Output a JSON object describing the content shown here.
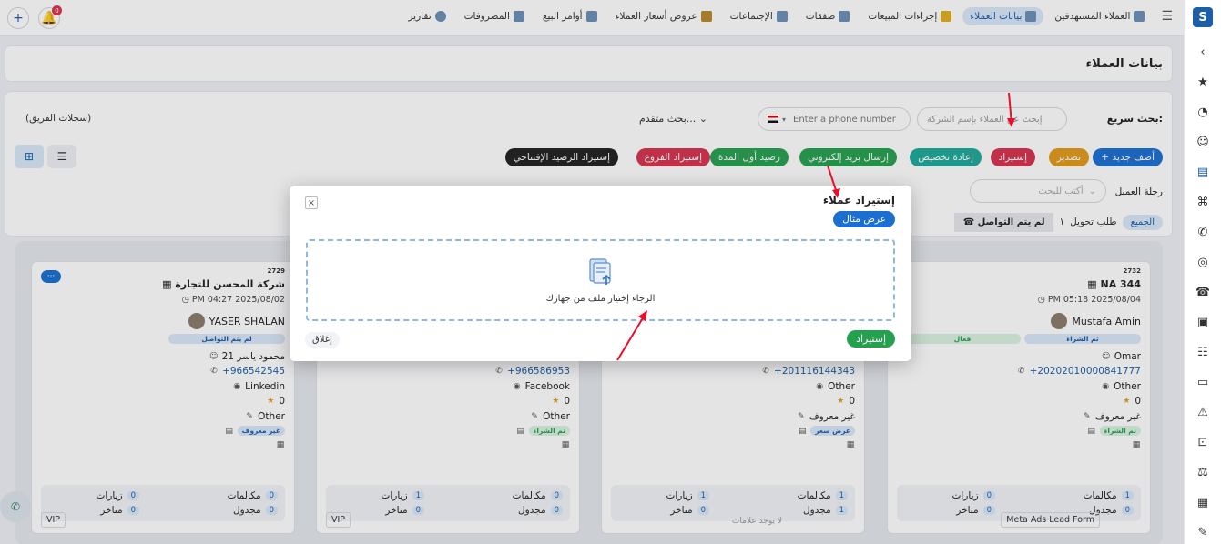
{
  "topnav": {
    "items": [
      {
        "label": "العملاء المستهدفين",
        "active": false
      },
      {
        "label": "بيانات العملاء",
        "active": true
      },
      {
        "label": "إجراءات المبيعات",
        "active": false
      },
      {
        "label": "صفقات",
        "active": false
      },
      {
        "label": "الإجتماعات",
        "active": false
      },
      {
        "label": "عروض أسعار العملاء",
        "active": false
      },
      {
        "label": "أوامر البيع",
        "active": false
      },
      {
        "label": "المصروفات",
        "active": false
      },
      {
        "label": "تقارير",
        "active": false
      }
    ],
    "notification_count": "0"
  },
  "page": {
    "title": "بيانات العملاء"
  },
  "filters": {
    "quick_search_label": "بحث سريع:",
    "company_search_placeholder": "إبحث عن العملاء بإسم الشركة",
    "phone_placeholder": "Enter a phone number",
    "advanced_search": "بحث متقدم...",
    "team_records": "(سجلات الفريق)",
    "journey_label": "رحلة العميل",
    "journey_placeholder": "أكتب للبحث"
  },
  "actions": [
    {
      "label": "+ أضف جديد",
      "color": "#1c6fd1"
    },
    {
      "label": "تصدير",
      "color": "#e09a1b"
    },
    {
      "label": "إستيراد",
      "color": "#d6334d"
    },
    {
      "label": "إعادة تخصيص",
      "color": "#1fa99a"
    },
    {
      "label": "إرسال بريد إلكتروني",
      "color": "#25a04f"
    },
    {
      "label": "رصيد أول المدة",
      "color": "#25a04f"
    },
    {
      "label": "إستيراد الفروع",
      "color": "#d6334d"
    },
    {
      "label": "إستيراد الرصيد الإفتتاحي",
      "color": "#222222"
    }
  ],
  "stages": {
    "all": "الجميع",
    "transfer": "طلب تحويل",
    "count": "١",
    "not_contacted": "لم يتم التواصل"
  },
  "cards": [
    {
      "id": "2732",
      "name": "NA 344",
      "date": "PM 05:18 2025/08/04",
      "owner": "Mustafa Amin",
      "pill_a": "تم الشراء",
      "pill_b": "فعال",
      "contact": "Omar",
      "phone": "+20202010000841777",
      "source": "Other",
      "rating": "0",
      "type": "غير معروف",
      "status": "تم الشراء",
      "calls": "1",
      "visits": "0",
      "scheduled": "0",
      "overdue": "0",
      "tag": "Meta Ads Lead Form"
    },
    {
      "phone": "+201116144343",
      "source": "Other",
      "rating": "0",
      "type": "غير معروف",
      "status": "عرض سعر",
      "calls": "1",
      "visits": "1",
      "scheduled": "1",
      "overdue": "0",
      "tag": "لا يوجد علامات"
    },
    {
      "phone": "+966586953",
      "source": "Facebook",
      "rating": "0",
      "type": "Other",
      "status": "تم الشراء",
      "calls": "0",
      "visits": "1",
      "scheduled": "0",
      "overdue": "0",
      "tag": "VIP"
    },
    {
      "id": "2729",
      "name": "شركة المحسن للتجارة",
      "date": "PM 04:27 2025/08/02",
      "owner": "YASER SHALAN",
      "pill_a": "لم يتم التواصل",
      "contact": "محمود ياسر 21",
      "phone": "+966542545",
      "source": "Linkedin",
      "rating": "0",
      "type": "Other",
      "status": "غير معروف",
      "calls": "0",
      "visits": "0",
      "scheduled": "0",
      "overdue": "0",
      "tag": "VIP",
      "more": "···"
    }
  ],
  "labels": {
    "calls": "مكالمات",
    "visits": "زيارات",
    "scheduled": "مجدول",
    "overdue": "متاخر"
  },
  "modal": {
    "title": "إستيراد عملاء",
    "example_button": "عرض مثال",
    "dropzone_text": "الرجاء إختيار ملف من جهازك",
    "import_button": "إستيراد",
    "cancel_button": "إغلاق",
    "close_icon": "×"
  },
  "colors": {
    "primary": "#1c6fd1",
    "success": "#25a04f",
    "danger": "#d6334d",
    "arrow": "#e8102a"
  }
}
